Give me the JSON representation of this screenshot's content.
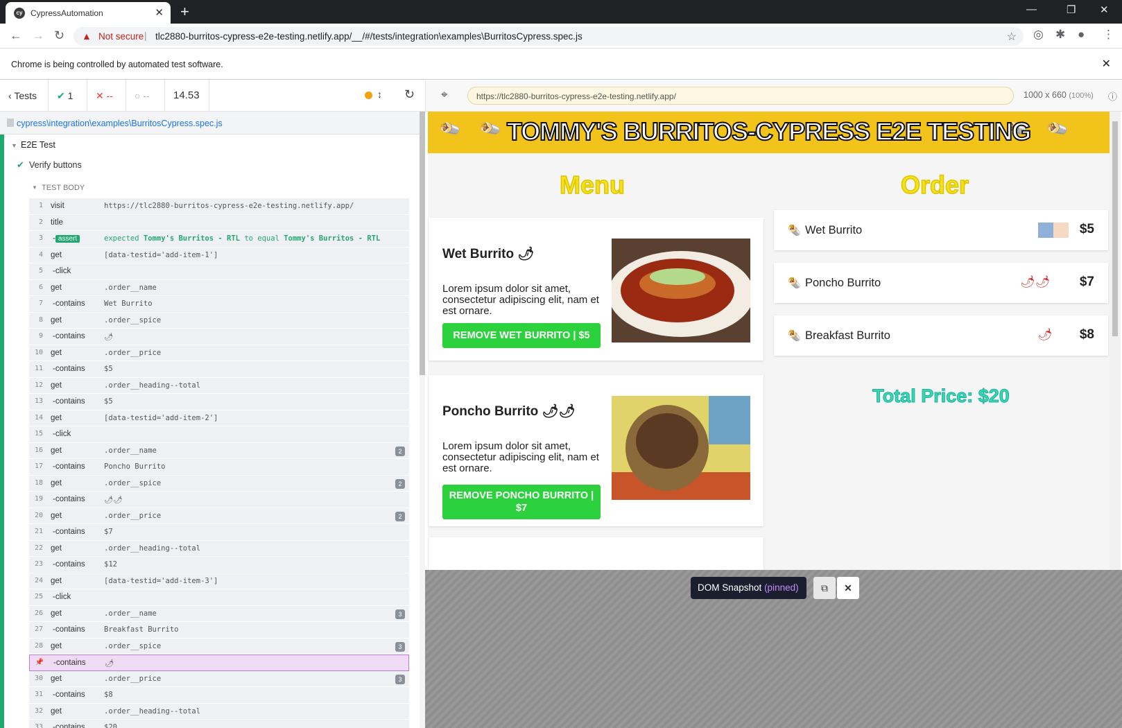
{
  "browser": {
    "tab_title": "CypressAutomation",
    "not_secure": "Not secure",
    "url": "tlc2880-burritos-cypress-e2e-testing.netlify.app/__/#/tests/integration\\examples\\BurritosCypress.spec.js",
    "info_message": "Chrome is being controlled by automated test software."
  },
  "runner": {
    "tests_label": "Tests",
    "passed": "1",
    "failed": "--",
    "pending": "--",
    "duration": "14.53",
    "spec_path": "cypress\\integration\\examples\\BurritosCypress.spec.js",
    "suite": "E2E Test",
    "test": "Verify buttons",
    "section": "TEST BODY",
    "commands": [
      {
        "n": "1",
        "cmd": "visit",
        "msg": "https://tlc2880-burritos-cypress-e2e-testing.netlify.app/",
        "sub": false
      },
      {
        "n": "2",
        "cmd": "title",
        "msg": "",
        "sub": false
      },
      {
        "n": "3",
        "cmd": "assert",
        "msg": "",
        "sub": true,
        "assert": true
      },
      {
        "n": "4",
        "cmd": "get",
        "msg": "[data-testid='add-item-1']",
        "sub": false
      },
      {
        "n": "5",
        "cmd": "-click",
        "msg": "",
        "sub": true
      },
      {
        "n": "6",
        "cmd": "get",
        "msg": ".order__name",
        "sub": false
      },
      {
        "n": "7",
        "cmd": "-contains",
        "msg": "Wet Burrito",
        "sub": true
      },
      {
        "n": "8",
        "cmd": "get",
        "msg": ".order__spice",
        "sub": false
      },
      {
        "n": "9",
        "cmd": "-contains",
        "msg": "🌶",
        "sub": true
      },
      {
        "n": "10",
        "cmd": "get",
        "msg": ".order__price",
        "sub": false
      },
      {
        "n": "11",
        "cmd": "-contains",
        "msg": "$5",
        "sub": true
      },
      {
        "n": "12",
        "cmd": "get",
        "msg": ".order__heading--total",
        "sub": false
      },
      {
        "n": "13",
        "cmd": "-contains",
        "msg": "$5",
        "sub": true
      },
      {
        "n": "14",
        "cmd": "get",
        "msg": "[data-testid='add-item-2']",
        "sub": false
      },
      {
        "n": "15",
        "cmd": "-click",
        "msg": "",
        "sub": true
      },
      {
        "n": "16",
        "cmd": "get",
        "msg": ".order__name",
        "sub": false,
        "badge": "2"
      },
      {
        "n": "17",
        "cmd": "-contains",
        "msg": "Poncho Burrito",
        "sub": true
      },
      {
        "n": "18",
        "cmd": "get",
        "msg": ".order__spice",
        "sub": false,
        "badge": "2"
      },
      {
        "n": "19",
        "cmd": "-contains",
        "msg": "🌶🌶",
        "sub": true
      },
      {
        "n": "20",
        "cmd": "get",
        "msg": ".order__price",
        "sub": false,
        "badge": "2"
      },
      {
        "n": "21",
        "cmd": "-contains",
        "msg": "$7",
        "sub": true
      },
      {
        "n": "22",
        "cmd": "get",
        "msg": ".order__heading--total",
        "sub": false
      },
      {
        "n": "23",
        "cmd": "-contains",
        "msg": "$12",
        "sub": true
      },
      {
        "n": "24",
        "cmd": "get",
        "msg": "[data-testid='add-item-3']",
        "sub": false
      },
      {
        "n": "25",
        "cmd": "-click",
        "msg": "",
        "sub": true
      },
      {
        "n": "26",
        "cmd": "get",
        "msg": ".order__name",
        "sub": false,
        "badge": "3"
      },
      {
        "n": "27",
        "cmd": "-contains",
        "msg": "Breakfast Burrito",
        "sub": true
      },
      {
        "n": "28",
        "cmd": "get",
        "msg": ".order__spice",
        "sub": false,
        "badge": "3"
      },
      {
        "n": "",
        "cmd": "-contains",
        "msg": "🌶",
        "sub": true,
        "pinned": true
      },
      {
        "n": "30",
        "cmd": "get",
        "msg": ".order__price",
        "sub": false,
        "badge": "3"
      },
      {
        "n": "31",
        "cmd": "-contains",
        "msg": "$8",
        "sub": true
      },
      {
        "n": "32",
        "cmd": "get",
        "msg": ".order__heading--total",
        "sub": false
      },
      {
        "n": "33",
        "cmd": "-contains",
        "msg": "$20",
        "sub": true
      }
    ],
    "assert_parts": {
      "expected": "expected",
      "a": "Tommy's Burritos - RTL",
      "to": "to equal",
      "b": "Tommy's Burritos - RTL"
    }
  },
  "aut": {
    "url": "https://tlc2880-burritos-cypress-e2e-testing.netlify.app/",
    "dims": "1000 x 660",
    "pct": "(100%)",
    "banner": "TOMMY'S BURRITOS-CYPRESS E2E TESTING",
    "menu_heading": "Menu",
    "order_heading": "Order",
    "menu_items": [
      {
        "name": "Wet Burrito",
        "spice": "🌶",
        "desc": "Lorem ipsum dolor sit amet, consectetur adipiscing elit, nam et est ornare.",
        "button": "REMOVE WET BURRITO | $5"
      },
      {
        "name": "Poncho Burrito",
        "spice": "🌶🌶",
        "desc": "Lorem ipsum dolor sit amet, consectetur adipiscing elit, nam et est ornare.",
        "button": "REMOVE PONCHO BURRITO | $7"
      }
    ],
    "orders": [
      {
        "name": "Wet Burrito",
        "spice": "",
        "price": "$5"
      },
      {
        "name": "Poncho Burrito",
        "spice": "🌶🌶",
        "price": "$7"
      },
      {
        "name": "Breakfast Burrito",
        "spice": "🌶",
        "price": "$8"
      }
    ],
    "total": "Total Price: $20"
  },
  "snapshot": {
    "label": "DOM Snapshot",
    "pinned": "(pinned)"
  }
}
